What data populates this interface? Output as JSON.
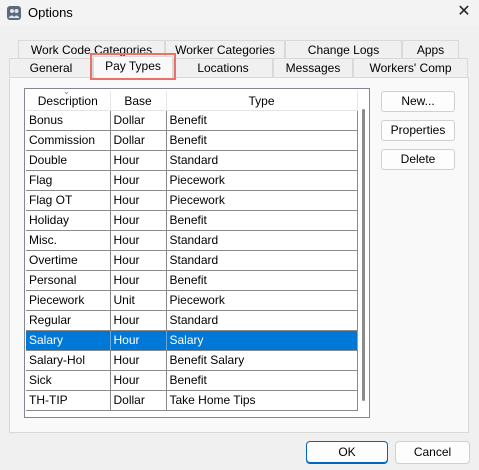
{
  "window": {
    "title": "Options",
    "icon": "people-group-icon",
    "close_glyph": "✕"
  },
  "tabs_row_back": [
    {
      "label": "Work Code Categories"
    },
    {
      "label": "Worker Categories"
    },
    {
      "label": "Change Logs"
    },
    {
      "label": "Apps"
    }
  ],
  "tabs_row_front": [
    {
      "label": "General"
    },
    {
      "label": "Pay Types",
      "active": true
    },
    {
      "label": "Locations"
    },
    {
      "label": "Messages"
    },
    {
      "label": "Workers' Comp"
    }
  ],
  "colors": {
    "selection": "#0078d7",
    "highlight_outline": "#e8716a",
    "ok_border": "#0067c0"
  },
  "pay_types_table": {
    "sorted_column": "Description",
    "columns": [
      "Description",
      "Base",
      "Type"
    ],
    "rows": [
      [
        "Bonus",
        "Dollar",
        "Benefit"
      ],
      [
        "Commission",
        "Dollar",
        "Benefit"
      ],
      [
        "Double",
        "Hour",
        "Standard"
      ],
      [
        "Flag",
        "Hour",
        "Piecework"
      ],
      [
        "Flag OT",
        "Hour",
        "Piecework"
      ],
      [
        "Holiday",
        "Hour",
        "Benefit"
      ],
      [
        "Misc.",
        "Hour",
        "Standard"
      ],
      [
        "Overtime",
        "Hour",
        "Standard"
      ],
      [
        "Personal",
        "Hour",
        "Benefit"
      ],
      [
        "Piecework",
        "Unit",
        "Piecework"
      ],
      [
        "Regular",
        "Hour",
        "Standard"
      ],
      [
        "Salary",
        "Hour",
        "Salary"
      ],
      [
        "Salary-Hol",
        "Hour",
        "Benefit Salary"
      ],
      [
        "Sick",
        "Hour",
        "Benefit"
      ],
      [
        "TH-TIP",
        "Dollar",
        "Take Home Tips"
      ]
    ],
    "selected_row": "Salary"
  },
  "side_buttons": {
    "new": "New...",
    "properties": "Properties",
    "delete": "Delete"
  },
  "dialog_buttons": {
    "ok": "OK",
    "cancel": "Cancel"
  }
}
